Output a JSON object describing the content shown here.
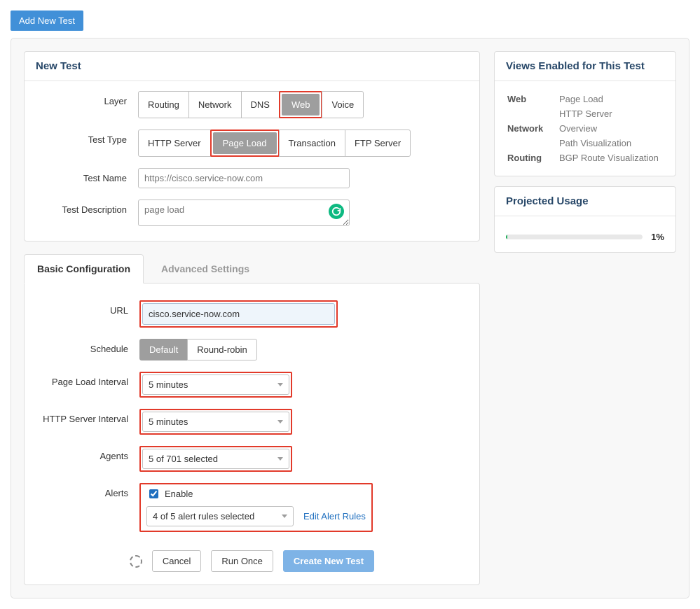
{
  "add_new_test_label": "Add New Test",
  "new_test": {
    "title": "New Test",
    "layer": {
      "label": "Layer",
      "options": [
        "Routing",
        "Network",
        "DNS",
        "Web",
        "Voice"
      ],
      "selected": "Web"
    },
    "test_type": {
      "label": "Test Type",
      "options": [
        "HTTP Server",
        "Page Load",
        "Transaction",
        "FTP Server"
      ],
      "selected": "Page Load"
    },
    "test_name": {
      "label": "Test Name",
      "placeholder": "https://cisco.service-now.com"
    },
    "test_description": {
      "label": "Test Description",
      "placeholder": "page load"
    }
  },
  "tabs": {
    "basic": "Basic Configuration",
    "advanced": "Advanced Settings",
    "active": "basic"
  },
  "basic_config": {
    "url": {
      "label": "URL",
      "value": "cisco.service-now.com"
    },
    "schedule": {
      "label": "Schedule",
      "options": [
        "Default",
        "Round-robin"
      ],
      "selected": "Default"
    },
    "page_load_interval": {
      "label": "Page Load Interval",
      "value": "5 minutes"
    },
    "http_server_interval": {
      "label": "HTTP Server Interval",
      "value": "5 minutes"
    },
    "agents": {
      "label": "Agents",
      "value": "5 of 701 selected"
    },
    "alerts": {
      "label": "Alerts",
      "enable_label": "Enable",
      "enabled": true,
      "rules": "4 of 5 alert rules selected",
      "edit_link": "Edit Alert Rules"
    }
  },
  "views_panel": {
    "title": "Views Enabled for This Test",
    "rows": [
      {
        "cat": "Web",
        "items": [
          "Page Load",
          "HTTP Server"
        ]
      },
      {
        "cat": "Network",
        "items": [
          "Overview",
          "Path Visualization"
        ]
      },
      {
        "cat": "Routing",
        "items": [
          "BGP Route Visualization"
        ]
      }
    ]
  },
  "usage_panel": {
    "title": "Projected Usage",
    "pct": "1%"
  },
  "footer": {
    "cancel": "Cancel",
    "run_once": "Run Once",
    "create": "Create New Test"
  }
}
